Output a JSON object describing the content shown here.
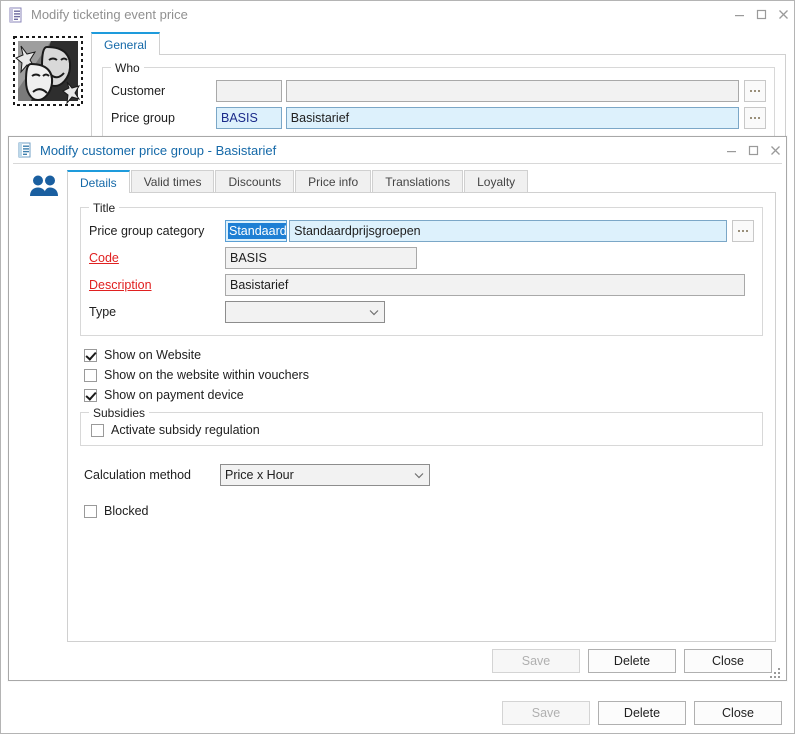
{
  "outer_window": {
    "title": "Modify ticketing event price",
    "icon": "document-list-icon",
    "controls": {
      "minimize": "minimize-icon",
      "maximize": "maximize-icon",
      "close": "close-icon"
    },
    "side_icon": "theater-masks-icon",
    "tabs": [
      {
        "label": "General",
        "active": true
      }
    ],
    "who_group": {
      "title": "Who",
      "rows": [
        {
          "label": "Customer",
          "code_value": "",
          "name_value": "",
          "focused": false,
          "ellipsis": "..."
        },
        {
          "label": "Price group",
          "code_value": "BASIS",
          "name_value": "Basistarief",
          "focused": true,
          "ellipsis": "..."
        }
      ]
    },
    "buttons": [
      {
        "label": "Save",
        "disabled": true
      },
      {
        "label": "Delete",
        "disabled": false
      },
      {
        "label": "Close",
        "disabled": false
      }
    ]
  },
  "inner_window": {
    "title": "Modify customer price group - Basistarief",
    "icon": "document-list-icon",
    "controls": {
      "minimize": "minimize-icon",
      "maximize": "maximize-icon",
      "close": "close-icon"
    },
    "side_icon": "people-icon",
    "tabs": [
      {
        "label": "Details",
        "active": true
      },
      {
        "label": "Valid times",
        "active": false
      },
      {
        "label": "Discounts",
        "active": false
      },
      {
        "label": "Price info",
        "active": false
      },
      {
        "label": "Translations",
        "active": false
      },
      {
        "label": "Loyalty",
        "active": false
      }
    ],
    "title_group": {
      "title": "Title",
      "price_group_category": {
        "label": "Price group category",
        "code_value": "Standaard",
        "code_selected": true,
        "name_value": "Standaardprijsgroepen",
        "ellipsis": "..."
      },
      "code": {
        "label": "Code",
        "value": "BASIS",
        "required": true
      },
      "description": {
        "label": "Description",
        "value": "Basistarief",
        "required": true
      },
      "type": {
        "label": "Type",
        "value": "",
        "placeholder": ""
      }
    },
    "checkboxes": [
      {
        "label": "Show on Website",
        "checked": true
      },
      {
        "label": "Show on the website within vouchers",
        "checked": false
      },
      {
        "label": "Show on payment device",
        "checked": true
      }
    ],
    "subsidies_group": {
      "title": "Subsidies",
      "checkbox": {
        "label": "Activate subsidy regulation",
        "checked": false
      }
    },
    "calculation_method": {
      "label": "Calculation method",
      "value": "Price x Hour"
    },
    "blocked": {
      "label": "Blocked",
      "checked": false
    },
    "buttons": [
      {
        "label": "Save",
        "disabled": true
      },
      {
        "label": "Delete",
        "disabled": false
      },
      {
        "label": "Close",
        "disabled": false
      }
    ]
  },
  "colors": {
    "accent": "#1e9bdc",
    "title_active": "#1569a8",
    "title_inactive": "#909090",
    "required_label": "#e02020",
    "selection": "#1e7fd4",
    "field_focus_bg": "#ddf1fc",
    "icon_blue": "#1a5fa0"
  }
}
